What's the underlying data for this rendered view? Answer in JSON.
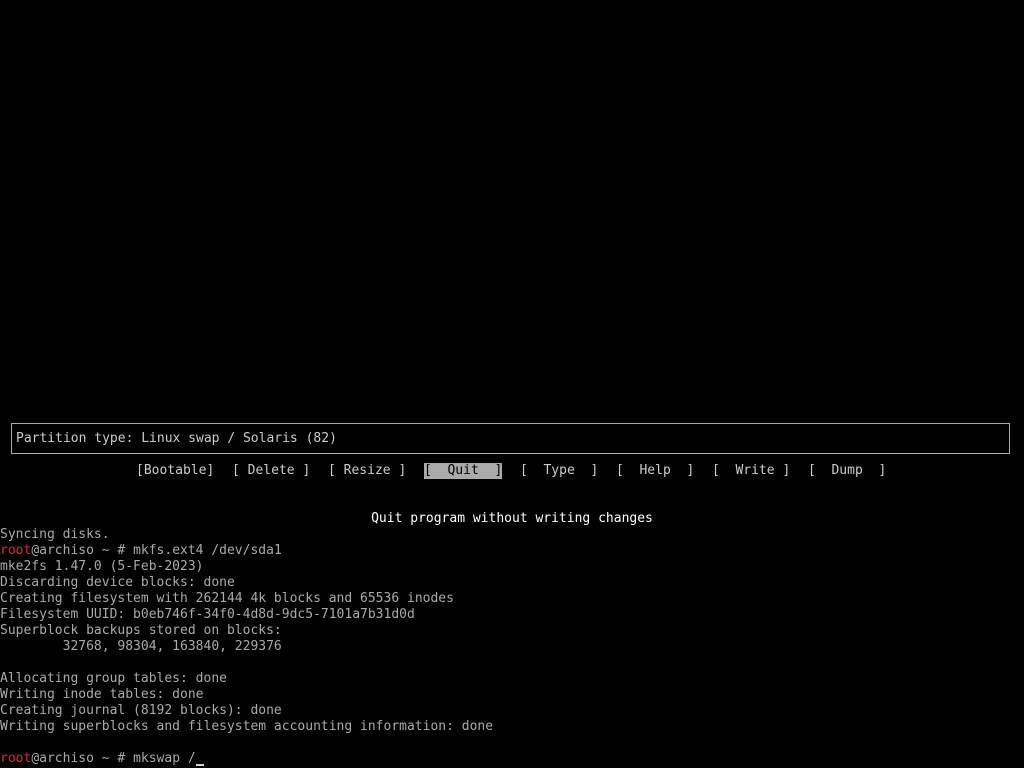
{
  "info_box": {
    "text": "Partition type: Linux swap / Solaris (82)"
  },
  "menu": {
    "items": [
      {
        "label": "[Bootable]"
      },
      {
        "label": "[ Delete ]"
      },
      {
        "label": "[ Resize ]"
      },
      {
        "label": "[  Quit  ]"
      },
      {
        "label": "[  Type  ]"
      },
      {
        "label": "[  Help  ]"
      },
      {
        "label": "[  Write ]"
      },
      {
        "label": "[  Dump  ]"
      }
    ]
  },
  "status_line": "Quit program without writing changes",
  "terminal": {
    "line_syncing": "Syncing disks.",
    "prompt1": {
      "user": "root",
      "host_dir": "@archiso ~ # ",
      "command": "mkfs.ext4 /dev/sda1"
    },
    "output": [
      "mke2fs 1.47.0 (5-Feb-2023)",
      "Discarding device blocks: done",
      "Creating filesystem with 262144 4k blocks and 65536 inodes",
      "Filesystem UUID: b0eb746f-34f0-4d8d-9dc5-7101a7b31d0d",
      "Superblock backups stored on blocks:",
      "        32768, 98304, 163840, 229376",
      "",
      "Allocating group tables: done",
      "Writing inode tables: done",
      "Creating journal (8192 blocks): done",
      "Writing superblocks and filesystem accounting information: done"
    ],
    "prompt2": {
      "user": "root",
      "host_dir": "@archiso ~ # ",
      "command": "mkswap /"
    }
  },
  "colors": {
    "background": "#000000",
    "text": "#aaaaaa",
    "prompt_user": "#cc3333",
    "selected_bg": "#aaaaaa"
  }
}
